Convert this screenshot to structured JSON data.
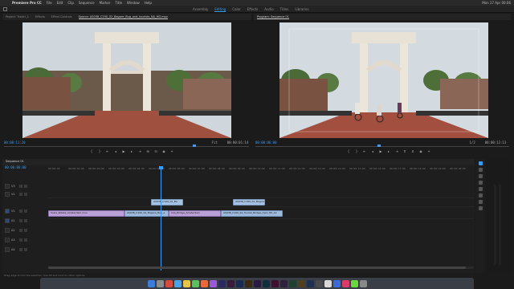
{
  "menubar": {
    "app_name": "Premiere Pro CC",
    "items": [
      "File",
      "Edit",
      "Clip",
      "Sequence",
      "Marker",
      "Title",
      "Window",
      "Help"
    ],
    "clock": "Mon 17 Apr  00:06"
  },
  "workspace": {
    "tabs": [
      "Assembly",
      "Editing",
      "Color",
      "Effects",
      "Audio",
      "Titles",
      "Libraries"
    ],
    "active": "Editing"
  },
  "source_panel": {
    "tabs": [
      "Project: Trailer_1",
      "Effects",
      "Effect Controls",
      "Source: AS038_C190_02_Bagore_Bug_and_tourists_NA_HD.mov"
    ],
    "active_tab_index": 3,
    "timecode_current": "00:00:11:20",
    "fit": "Fit",
    "timecode_duration": "00:00:01:14"
  },
  "program_panel": {
    "tabs": [
      "Program: Sequence 01"
    ],
    "timecode_current": "00:00:06:00",
    "fit": "1/2",
    "timecode_duration": "00:00:12:13"
  },
  "timeline": {
    "tab": "Sequence 01",
    "timecode": "00:00:06:00",
    "ruler": [
      "00:00:00",
      "00:00:01:00",
      "00:00:02:00",
      "00:00:03:00",
      "00:00:04:00",
      "00:00:05:00",
      "00:00:06:00",
      "00:00:07:00",
      "00:00:08:00",
      "00:00:09:00",
      "00:00:10:00",
      "00:00:11:00",
      "00:00:12:00",
      "00:00:13:00",
      "00:00:14:00",
      "00:00:15:00",
      "00:00:16:00",
      "00:00:17:00",
      "00:00:18:00",
      "00:00:19:00",
      "00:00:20:00"
    ],
    "tracks": [
      {
        "name": "V3",
        "type": "video"
      },
      {
        "name": "V2",
        "type": "video"
      },
      {
        "name": "V1",
        "type": "video"
      },
      {
        "name": "A1",
        "type": "audio"
      },
      {
        "name": "A2",
        "type": "audio"
      },
      {
        "name": "A3",
        "type": "audio"
      },
      {
        "name": "A4",
        "type": "audio"
      }
    ],
    "clips": [
      {
        "label": "AS038_C190_02_Ba",
        "track": "V2"
      },
      {
        "label": "AS038_C190_02_Bagore",
        "track": "V2"
      },
      {
        "label": "Scale_Rotate_Amsterdam.mov",
        "track": "V1"
      },
      {
        "label": "AS038_C190_02_Bagore_Bug_a",
        "track": "V1"
      },
      {
        "label": "Clip_Bridge_Amsterdam",
        "track": "V1"
      },
      {
        "label": "AS038_C190_02_Tourist_Bridge_mp4_HD_12",
        "track": "V1"
      }
    ]
  },
  "status": {
    "text": "Drag edge to trim the selection. Use Alt and Cmd for other options."
  },
  "colors": {
    "accent": "#3d9cf0",
    "video_clip": "#9db9dc",
    "audio_clip": "#b9a0d6"
  }
}
